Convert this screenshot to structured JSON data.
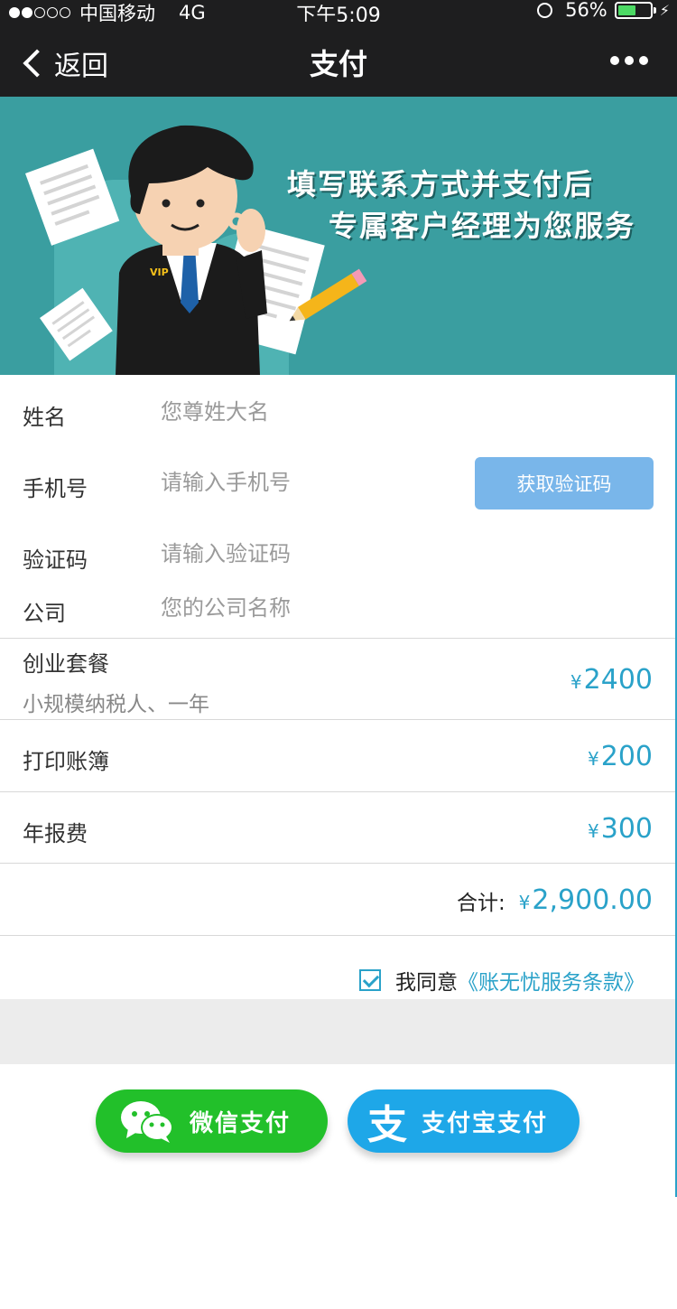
{
  "status_bar": {
    "carrier": "中国移动",
    "network": "4G",
    "time": "下午5:09",
    "battery": "56%"
  },
  "nav": {
    "back_label": "返回",
    "title": "支付"
  },
  "banner": {
    "line1": "填写联系方式并支付后",
    "line2": "专属客户经理为您服务",
    "badge": "VIP"
  },
  "form": {
    "name_label": "姓名",
    "name_placeholder": "您尊姓大名",
    "phone_label": "手机号",
    "phone_placeholder": "请输入手机号",
    "get_code_label": "获取验证码",
    "code_label": "验证码",
    "code_placeholder": "请输入验证码",
    "company_label": "公司",
    "company_placeholder": "您的公司名称"
  },
  "items": {
    "package_title": "创业套餐",
    "package_sub": "小规模纳税人、一年",
    "package_price": "2400",
    "print_label": "打印账簿",
    "print_price": "200",
    "annual_label": "年报费",
    "annual_price": "300",
    "currency": "¥"
  },
  "total": {
    "label": "合计:",
    "value": "2,900.00"
  },
  "agreement": {
    "text": "我同意",
    "link": "《账无忧服务条款》"
  },
  "payment": {
    "wechat_label": "微信支付",
    "alipay_label": "支付宝支付",
    "alipay_glyph": "支"
  },
  "colors": {
    "accent": "#2aa2c9",
    "banner_bg": "#3a9ea0",
    "wechat_green": "#22c02a",
    "alipay_blue": "#1ea7e8",
    "code_button": "#79b6ea"
  }
}
